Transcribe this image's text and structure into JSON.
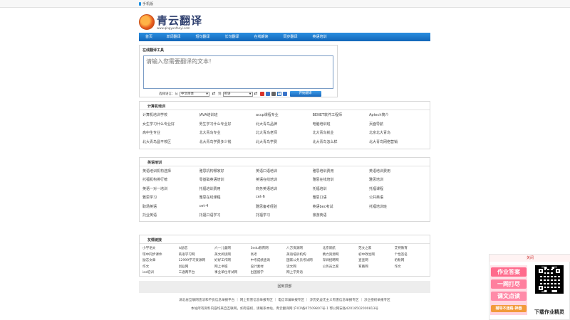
{
  "topbar": {
    "mobile_label": "手机版"
  },
  "logo": {
    "title": "青云翻译",
    "url": "www.qingyunfanyi.com"
  },
  "nav": [
    "首页",
    "单词翻译",
    "短句翻译",
    "长句翻译",
    "在线朗读",
    "同步翻译",
    "英语培训"
  ],
  "translator": {
    "title": "在线翻译工具",
    "placeholder": "请输入您需要翻译的文本！",
    "select_label": "选择语言：从",
    "from_lang": "中文简体",
    "to_label": "到",
    "to_lang": "英语",
    "button": "开始翻译"
  },
  "computer": {
    "title": "计算机培训",
    "items": [
      "计算机培训学校",
      "JAVA培训班",
      "accp课程专业",
      "BENET软件工程师",
      "Aptech简介",
      "女生学习什么专业好",
      "男生学习什么专业好",
      "北大青鸟品牌",
      "电脑培训班",
      "页面导航",
      "高中生专业",
      "北大青鸟专业",
      "北大青鸟老师",
      "北大青鸟就业",
      "北京北大青鸟",
      "北大青鸟昌平校区",
      "北大青鸟学费多少钱",
      "北大青鸟学费",
      "北大青鸟怎么样",
      "北大青鸟网络营销"
    ]
  },
  "english": {
    "title": "英语培训",
    "items": [
      "英语培训机构选择",
      "雅思机构哪家好",
      "英语口语培训",
      "雅思培训费用",
      "英语培训费用",
      "托福机构排行榜",
      "零基础英语培训",
      "英语在线培训",
      "雅思在线培训",
      "雅思培训",
      "英语一对一培训",
      "托福培训费用",
      "商务英语培训",
      "托福培训",
      "托福课程",
      "雅思学习",
      "雅思在线课程",
      "cet-6",
      "雅思口语",
      "公共英语",
      "职场英语",
      "cet-4",
      "雅思备考经验",
      "英语bec考试",
      "托福培训班",
      "托业英语",
      "托福口语学习",
      "托福学习",
      "旅游英语",
      ""
    ]
  },
  "links": {
    "title": "友情链接",
    "items": [
      "小学语文",
      "ls励志",
      "六一儿童网",
      "3edu教育网",
      "八方资源网",
      "北京新航",
      "范文之家",
      "艾特教育",
      "琼中同步课件",
      "英语学习网",
      "英文阅读网",
      "高考",
      "英语培训机构",
      "精力资源网",
      "初中政治网",
      "个性签名",
      "励志文章",
      "12999学习资源网",
      "好好工作网",
      "中考成绩查询",
      "国家公务员考试网",
      "深圳招聘网",
      "查查网",
      "奶粉网",
      "作文",
      "创业网",
      "网上书城",
      "设计素材",
      "读文网",
      "公务员之家",
      "育路网",
      "作文",
      "ios培训",
      "三通两平台",
      "事业单位考试网",
      "出国留学",
      "网上学英语"
    ]
  },
  "backtop": "回到顶部",
  "footer": {
    "line1": "湖北省互联网违法和不良信息举报平台 ｜ 网上有害信息举报专区 ｜ 电信诈骗举报专区 ｜ 涉历史虚无主义有害信息举报专区 ｜ 涉企侵权举报专区",
    "line2": "本站所有资料内容均来自互联网，如有侵权，请联系本站，青云翻译网 沪ICP备07509807号-1 鄂公网安备42018502000813号"
  },
  "ad": {
    "close": "关闭",
    "lines": [
      "作业答案",
      "一网打尽",
      "课文点读",
      "辅导不迷路·神器"
    ],
    "caption": "下载作业精灵"
  }
}
